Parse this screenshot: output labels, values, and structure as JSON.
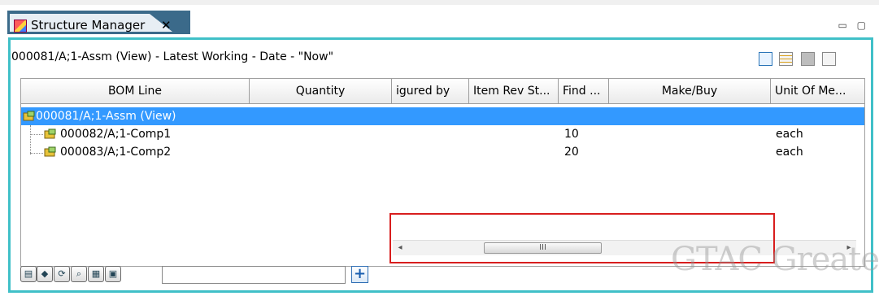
{
  "tab": {
    "title": "Structure Manager",
    "close": "✕"
  },
  "window_controls": "▭ ▢",
  "context_title": "000081/A;1-Assm (View) - Latest Working - Date - \"Now\"",
  "columns": [
    "BOM Line",
    "Quantity",
    "igured by",
    "Item Rev St...",
    "Find ...",
    "Make/Buy",
    "Unit Of Me..."
  ],
  "rows": [
    {
      "bom_line": "000081/A;1-Assm (View)",
      "find": "",
      "unit": "",
      "selected": true
    },
    {
      "bom_line": "000082/A;1-Comp1",
      "find": "10",
      "unit": "each",
      "selected": false
    },
    {
      "bom_line": "000083/A;1-Comp2",
      "find": "20",
      "unit": "each",
      "selected": false
    }
  ],
  "scrollbar": {
    "left": "◂",
    "thumb": "III",
    "right": "▸"
  },
  "watermark": "GTAC Greater",
  "colors": {
    "frame": "#40c0c8",
    "selection": "#3399ff",
    "highlight_box": "#d81e1e",
    "tab": "#3b6a8a"
  }
}
